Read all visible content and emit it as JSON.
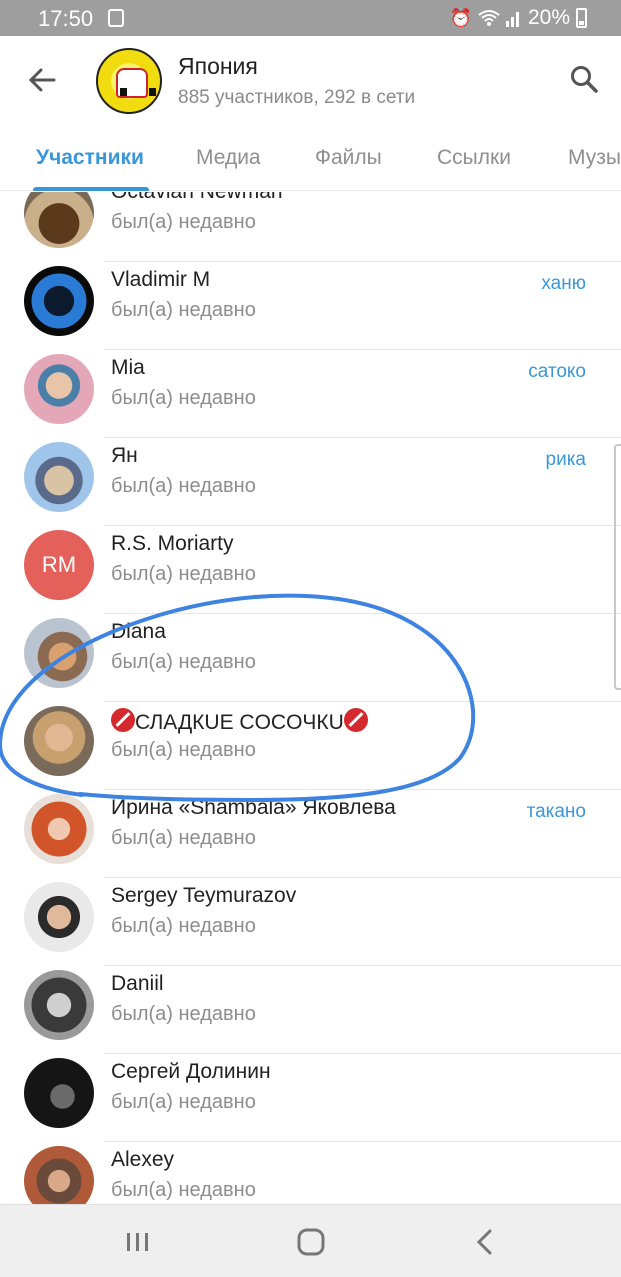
{
  "status_bar": {
    "time": "17:50",
    "battery": "20%",
    "notification_icon": "gallery-notification-icon",
    "alarm_icon": "alarm-icon",
    "wifi_icon": "wifi-icon",
    "signal_icon": "signal-icon"
  },
  "header": {
    "back_icon": "arrow-left-icon",
    "title": "Япония",
    "subtitle": "885 участников, 292 в сети",
    "search_icon": "search-icon"
  },
  "tabs": [
    {
      "label": "Участники",
      "active": true
    },
    {
      "label": "Медиа"
    },
    {
      "label": "Файлы"
    },
    {
      "label": "Ссылки"
    },
    {
      "label": "Музы"
    }
  ],
  "members": [
    {
      "name": "Octavian Newman",
      "status": "был(а) недавно",
      "tag": "",
      "avatar": "bull-statue"
    },
    {
      "name": "Vladimir M",
      "status": "был(а) недавно",
      "tag": "ханю",
      "avatar": "blue-dish"
    },
    {
      "name": "Mia",
      "status": "был(а) недавно",
      "tag": "сатоко",
      "avatar": "blossom-girl"
    },
    {
      "name": "Ян",
      "status": "был(а) недавно",
      "tag": "рика",
      "avatar": "sky-person"
    },
    {
      "name": "R.S. Moriarty",
      "status": "был(а) недавно",
      "tag": "",
      "avatar_initials": "RM"
    },
    {
      "name": "Diana",
      "status": "был(а) недавно",
      "tag": "",
      "avatar": "blonde-girl"
    },
    {
      "name": "СЛАДКUE COCOЧКU",
      "status": "был(а) недавно",
      "tag": "",
      "avatar": "swimsuit-girl"
    },
    {
      "name": "Ирина «Shambala» Яковлева",
      "status": "был(а) недавно",
      "tag": "такано",
      "avatar": "red-hair"
    },
    {
      "name": "Sergey Teymurazov",
      "status": "был(а) недавно",
      "tag": "",
      "avatar": "bearded-man"
    },
    {
      "name": "Daniil",
      "status": "был(а) недавно",
      "tag": "",
      "avatar": "bw-man"
    },
    {
      "name": "Сергей Долинин",
      "status": "был(а) недавно",
      "tag": "",
      "avatar": "dark-hat"
    },
    {
      "name": "Alexey",
      "status": "был(а) недавно",
      "tag": "",
      "avatar": "man-street"
    }
  ],
  "nav": {
    "recent_icon": "recent-apps-icon",
    "home_icon": "home-icon",
    "back_icon": "nav-back-icon"
  },
  "colors": {
    "accent": "#3a98d8",
    "annotation": "#3f83e0",
    "initials_bg": "#e3605b"
  }
}
